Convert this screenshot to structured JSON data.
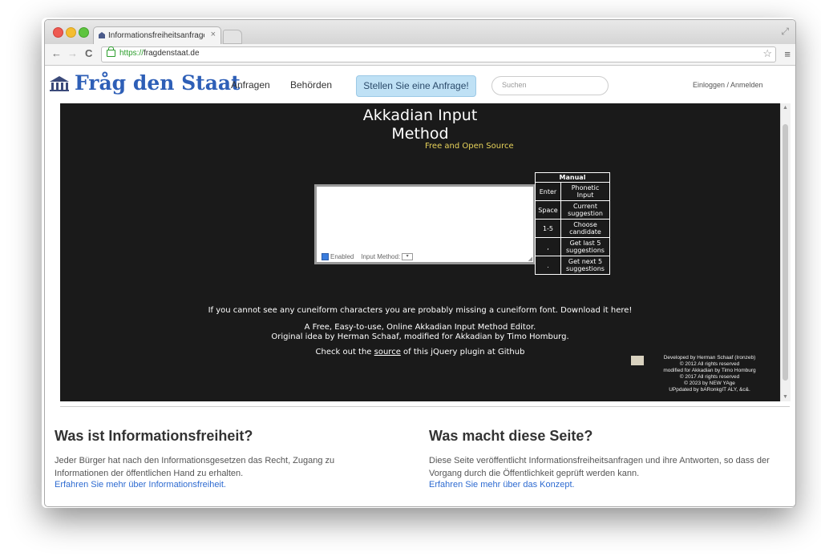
{
  "browser": {
    "tab_title": "Informationsfreiheitsanfrage",
    "tab_close": "×",
    "url_scheme": "https://",
    "url_host": "fragdenstaat.de",
    "nav_back": "←",
    "nav_forward": "→",
    "nav_reload": "C",
    "bookmark_star": "☆",
    "menu": "≡",
    "resize": "⤢"
  },
  "header": {
    "logo_text": "Fråg den Staat",
    "nav": [
      "Anfragen",
      "Behörden"
    ],
    "cta": "Stellen Sie eine Anfrage!",
    "search_placeholder": "Suchen",
    "login": "Einloggen / Anmelden"
  },
  "app": {
    "title_line1": "Akkadian Input",
    "title_line2": "Method",
    "subtitle": "Free and Open Source",
    "editor": {
      "enabled_label": "Enabled",
      "input_method_label": "Input Method:"
    },
    "manual": {
      "heading": "Manual",
      "rows": [
        {
          "key": "Enter",
          "desc1": "Phonetic",
          "desc2": "Input"
        },
        {
          "key": "Space",
          "desc1": "Current",
          "desc2": "suggestion"
        },
        {
          "key": "1-5",
          "desc1": "Choose",
          "desc2": "candidate"
        },
        {
          "key": ",",
          "desc1": "Get last 5",
          "desc2": "suggestions"
        },
        {
          "key": ".",
          "desc1": "Get next 5",
          "desc2": "suggestions"
        }
      ]
    },
    "font_notice": "If you cannot see any cuneiform characters you are probably missing a cuneiform font. Download it here!",
    "desc_line1": "A Free, Easy-to-use, Online Akkadian Input Method Editor.",
    "desc_line2": "Original idea by Herman Schaaf, modified for Akkadian by Timo Homburg.",
    "source_prefix": "Check out the ",
    "source_link": "source",
    "source_suffix": " of this jQuery plugin at Github",
    "credits": [
      "Developed by Herman Schaaf (Ironzeb)",
      "© 2012 All rights reserved",
      "modified for Akkadian by Timo Homburg",
      "© 2017 All rights reserved",
      "© 2023 by NEW YAge",
      "UPpdated by bARonkgIT ALY, &c&."
    ]
  },
  "content": {
    "left": {
      "heading": "Was ist Informationsfreiheit?",
      "text": "Jeder Bürger hat nach den Informationsgesetzen das Recht, Zugang zu Informationen der öffentlichen Hand zu erhalten.",
      "link": "Erfahren Sie mehr über Informationsfreiheit."
    },
    "right": {
      "heading": "Was macht diese Seite?",
      "text": "Diese Seite veröffentlicht Informationsfreiheitsanfragen und ihre Antworten, so dass der Vorgang durch die Öffentlichkeit geprüft werden kann.",
      "link": "Erfahren Sie mehr über das Konzept."
    }
  },
  "colors": {
    "app_bg": "#1a1a1a",
    "logo": "#2e5fb7",
    "subtitle": "#e8d35a",
    "cta_bg": "#bfe1f5",
    "link": "#2e6bd1"
  }
}
